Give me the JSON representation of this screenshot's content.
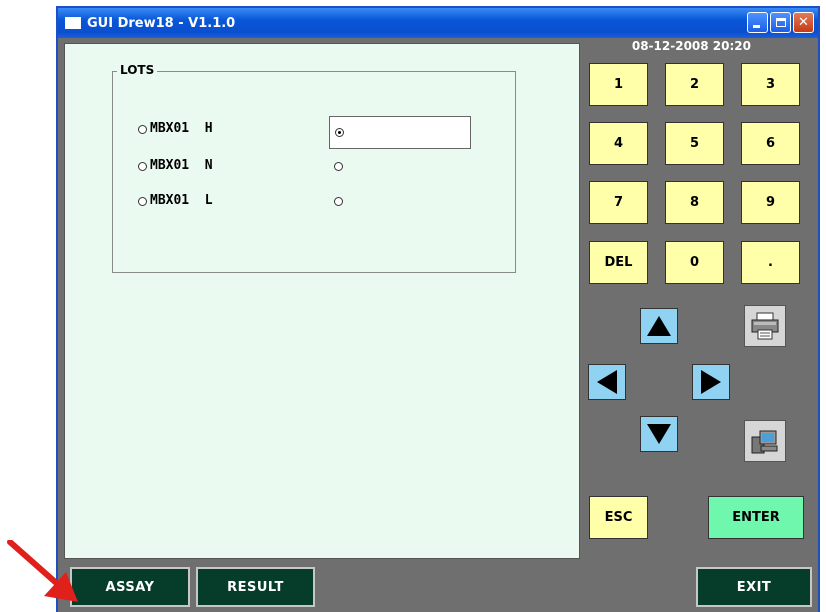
{
  "window": {
    "title": "GUI Drew18 - V1.1.0",
    "datetime": "08-12-2008 20:20"
  },
  "lots": {
    "group_label": "LOTS",
    "options": [
      {
        "label": "MBX01  H",
        "selected": false,
        "secondary_selected": true
      },
      {
        "label": "MBX01  N",
        "selected": false,
        "secondary_selected": false
      },
      {
        "label": "MBX01  L",
        "selected": false,
        "secondary_selected": false
      }
    ],
    "input_value": ""
  },
  "keypad": {
    "keys": [
      "1",
      "2",
      "3",
      "4",
      "5",
      "6",
      "7",
      "8",
      "9",
      "DEL",
      "0",
      "."
    ],
    "esc_label": "ESC",
    "enter_label": "ENTER"
  },
  "navigation": {
    "icons": [
      "arrow-up-icon",
      "arrow-left-icon",
      "arrow-right-icon",
      "arrow-down-icon",
      "printer-icon",
      "computer-icon"
    ]
  },
  "bottom_bar": {
    "assay_label": "ASSAY",
    "result_label": "RESULT",
    "exit_label": "EXIT"
  },
  "colors": {
    "titlebar": "#0a4fcf",
    "panel_bg": "#eafaf1",
    "body_bg": "#6f6f6f",
    "key_bg": "#ffffaa",
    "arrow_bg": "#8fd2f2",
    "enter_bg": "#6ff7ad",
    "bottom_btn_bg": "#063d2a",
    "annotation_arrow": "#e0201a"
  }
}
